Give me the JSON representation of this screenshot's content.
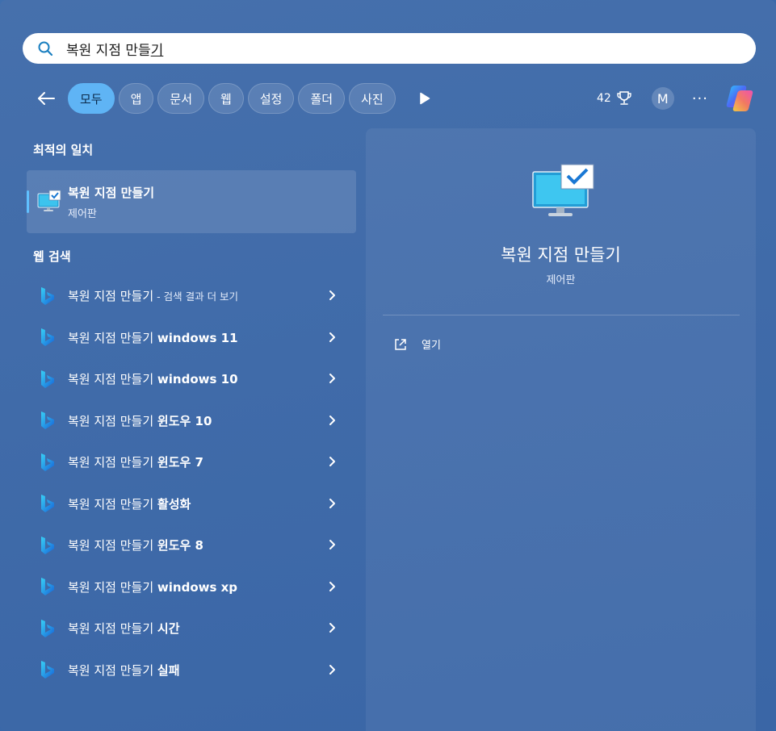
{
  "search": {
    "query_main": "복원 지점 만들",
    "query_end": "기"
  },
  "filters": {
    "chips": [
      "모두",
      "앱",
      "문서",
      "웹",
      "설정",
      "폴더",
      "사진"
    ],
    "points": "42",
    "avatar": "M",
    "more": "···"
  },
  "best_match": {
    "heading": "최적의 일치",
    "title": "복원 지점 만들기",
    "subtitle": "제어판"
  },
  "web_search": {
    "heading": "웹 검색",
    "items": [
      {
        "base": "복원 지점 만들기",
        "bold": "",
        "suffix": "- 검색 결과 더 보기"
      },
      {
        "base": "복원 지점 만들기 ",
        "bold": "windows 11",
        "suffix": ""
      },
      {
        "base": "복원 지점 만들기 ",
        "bold": "windows 10",
        "suffix": ""
      },
      {
        "base": "복원 지점 만들기 ",
        "bold": "윈도우 10",
        "suffix": ""
      },
      {
        "base": "복원 지점 만들기 ",
        "bold": "윈도우 7",
        "suffix": ""
      },
      {
        "base": "복원 지점 만들기 ",
        "bold": "활성화",
        "suffix": ""
      },
      {
        "base": "복원 지점 만들기 ",
        "bold": "윈도우 8",
        "suffix": ""
      },
      {
        "base": "복원 지점 만들기 ",
        "bold": "windows xp",
        "suffix": ""
      },
      {
        "base": "복원 지점 만들기 ",
        "bold": "시간",
        "suffix": ""
      },
      {
        "base": "복원 지점 만들기 ",
        "bold": "실패",
        "suffix": ""
      }
    ]
  },
  "preview": {
    "title": "복원 지점 만들기",
    "subtitle": "제어판",
    "action_open": "열기"
  },
  "colors": {
    "accent_chip": "#5fb4f5",
    "background": "#3f6fae"
  }
}
